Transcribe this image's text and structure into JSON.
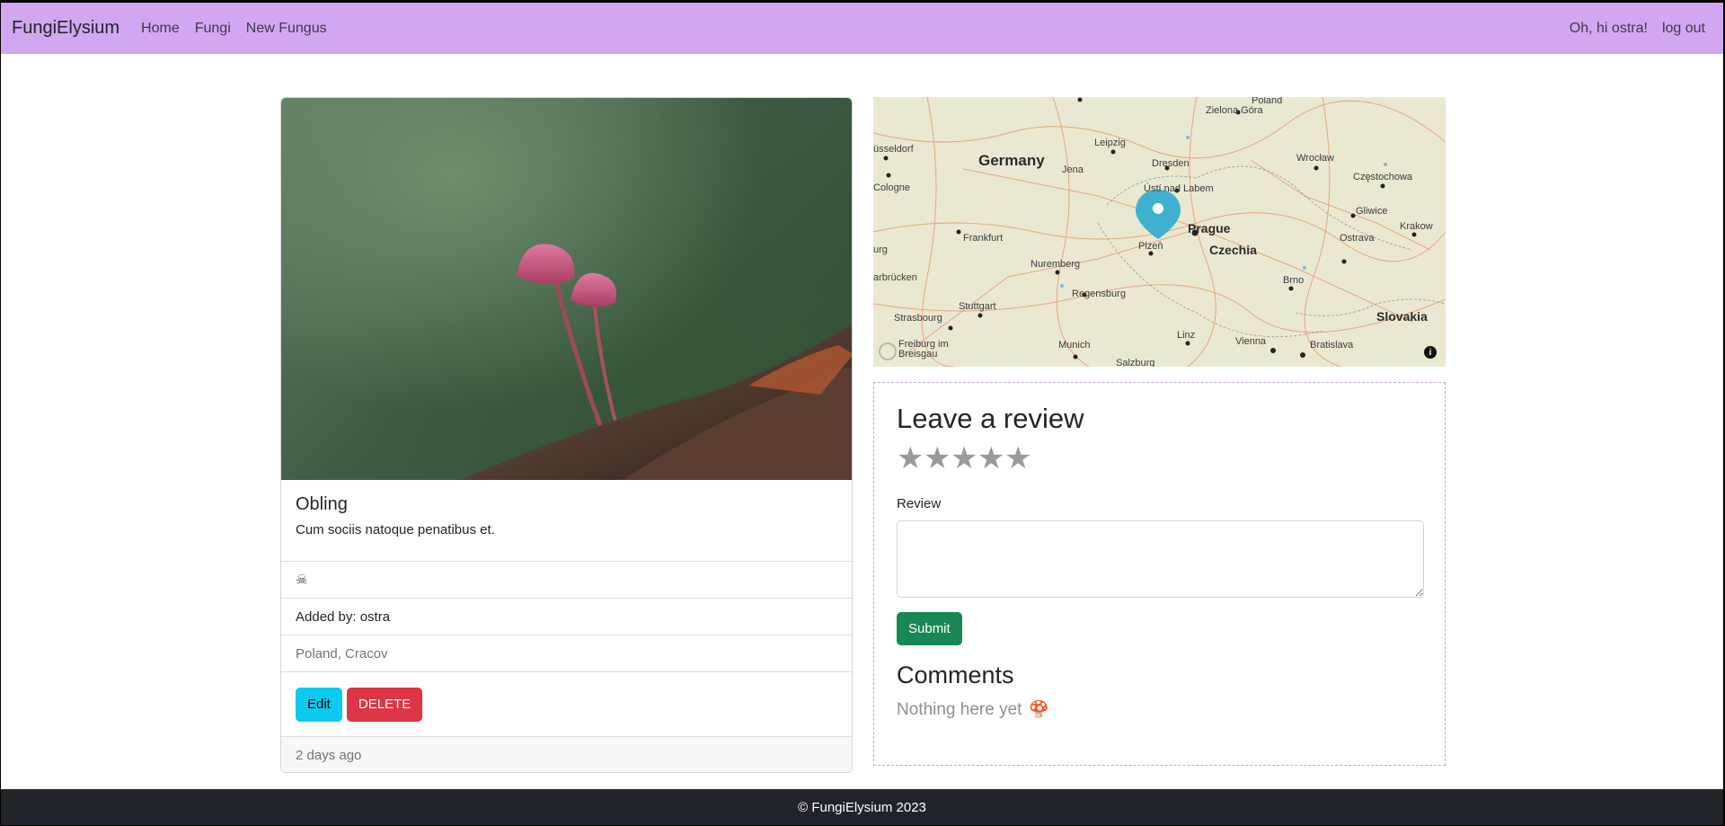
{
  "nav": {
    "brand": "FungiElysium",
    "links": [
      "Home",
      "Fungi",
      "New Fungus"
    ],
    "greeting": "Oh, hi ostra!",
    "logout": "log out"
  },
  "fungus": {
    "title": "Obling",
    "description": "Cum sociis natoque penatibus et.",
    "toxicity_icon": "skull-crossbones-icon",
    "added_by": "Added by: ostra",
    "location": "Poland, Cracov",
    "edit_label": "Edit",
    "delete_label": "DELETE",
    "added_ago": "2 days ago"
  },
  "map": {
    "labels": {
      "germany": "Germany",
      "czechia": "Czechia",
      "slovakia": "Slovakia",
      "poland": "Poland",
      "prague": "Prague",
      "plzen": "Plzeň",
      "leipzig": "Leipzig",
      "dresden": "Dresden",
      "jena": "Jena",
      "usti": "Ústí nad Labem",
      "zielona": "Zielona Góra",
      "wroclaw": "Wrocław",
      "czestochowa": "Częstochowa",
      "gliwice": "Gliwice",
      "krakow": "Krakow",
      "ostrava": "Ostrava",
      "brno": "Brno",
      "frankfurt": "Frankfurt",
      "nuremberg": "Nuremberg",
      "regensburg": "Regensburg",
      "stuttgart": "Stuttgart",
      "strasbourg": "Strasbourg",
      "munich": "Munich",
      "linz": "Linz",
      "vienna": "Vienna",
      "bratislava": "Bratislava",
      "cologne": "Cologne",
      "dusseldorf": "üsseldorf",
      "saarbrucken": "arbrücken",
      "burg": "urg",
      "freiburg": "Freiburg im Breisgau",
      "salzburg": "Salzburg"
    },
    "attribution_icon": "info-icon",
    "marker_icon": "map-pin-icon"
  },
  "review": {
    "heading": "Leave a review",
    "rating_max": 5,
    "field_label": "Review",
    "submit_label": "Submit",
    "comments_heading": "Comments",
    "empty_text": "Nothing here yet",
    "empty_icon": "🍄"
  },
  "footer": {
    "text": "© FungiElysium 2023"
  },
  "colors": {
    "navbar": "#d1a7f2",
    "edit": "#0dcaf0",
    "delete": "#dc3545",
    "submit": "#198754",
    "footer": "#212529",
    "marker": "#3fb1ce"
  }
}
